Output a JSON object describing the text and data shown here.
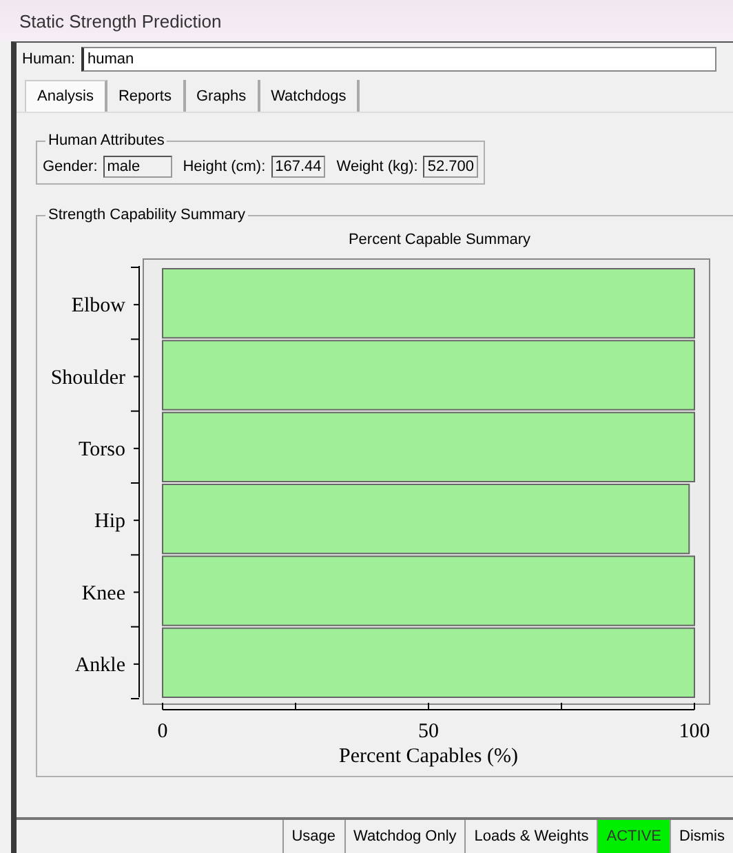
{
  "window": {
    "title": "Static Strength Prediction"
  },
  "human": {
    "label": "Human:",
    "value": "human"
  },
  "tabs": [
    {
      "label": "Analysis",
      "selected": true
    },
    {
      "label": "Reports",
      "selected": false
    },
    {
      "label": "Graphs",
      "selected": false
    },
    {
      "label": "Watchdogs",
      "selected": false
    }
  ],
  "human_attributes": {
    "title": "Human Attributes",
    "fields": [
      {
        "label": "Gender:",
        "value": "male"
      },
      {
        "label": "Height (cm):",
        "value": "167.44"
      },
      {
        "label": "Weight (kg):",
        "value": "52.700"
      }
    ]
  },
  "strength_summary": {
    "title": "Strength Capability Summary",
    "chart_data": {
      "type": "bar",
      "orientation": "horizontal",
      "title": "Percent Capable Summary",
      "xlabel": "Percent Capables (%)",
      "categories": [
        "Elbow",
        "Shoulder",
        "Torso",
        "Hip",
        "Knee",
        "Ankle"
      ],
      "series": [
        {
          "color": "#a0ee98",
          "values": [
            100,
            100,
            100,
            99,
            100,
            100
          ]
        }
      ],
      "xlim": [
        0,
        100
      ],
      "xticks": [
        0,
        50,
        100
      ]
    }
  },
  "status_bar": [
    {
      "label": "Usage",
      "highlighted": false
    },
    {
      "label": "Watchdog Only",
      "highlighted": false
    },
    {
      "label": "Loads & Weights",
      "highlighted": false
    },
    {
      "label": "ACTIVE",
      "highlighted": true
    },
    {
      "label": "Dismis",
      "highlighted": false
    }
  ]
}
